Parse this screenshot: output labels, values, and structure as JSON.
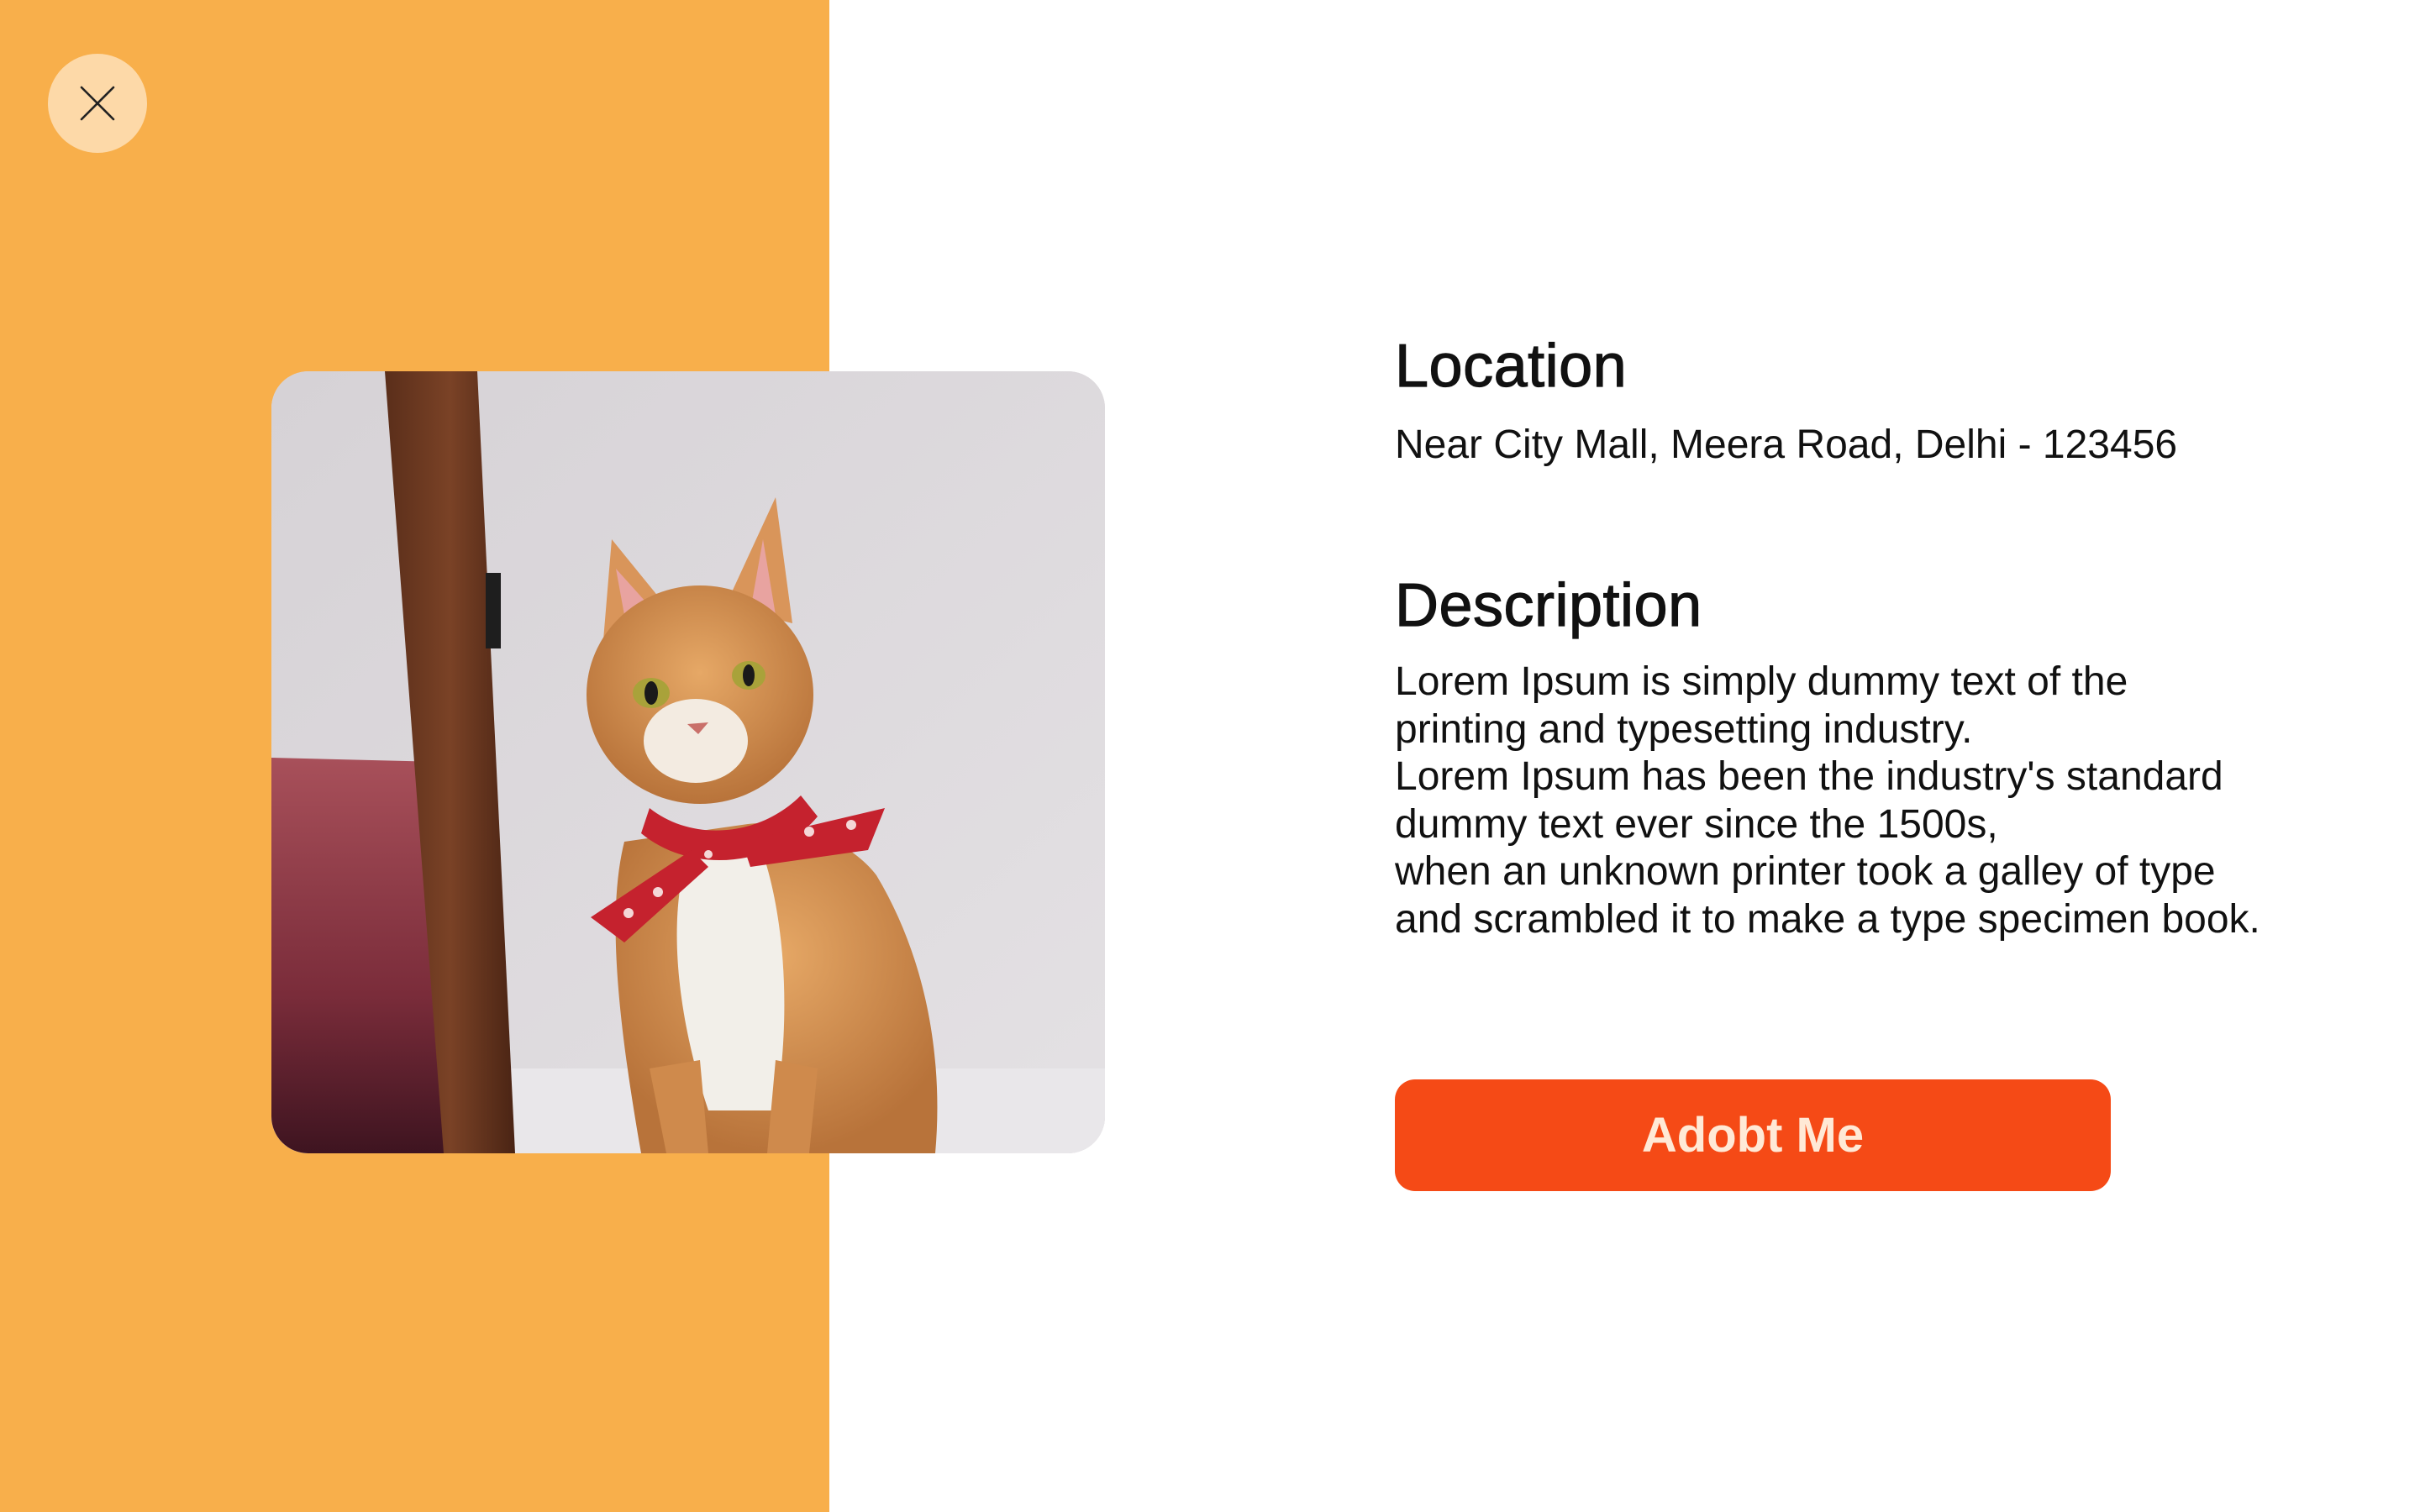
{
  "close": {
    "icon": "close-icon"
  },
  "photo": {
    "subject": "cat-photo"
  },
  "location": {
    "title": "Location",
    "address": "Near City Mall, Meera Road, Delhi - 123456"
  },
  "description": {
    "title": "Description",
    "lines": [
      "Lorem Ipsum is simply dummy text of the",
      "printing and typesetting industry.",
      "Lorem Ipsum has been the industry's standard",
      "dummy text ever since the 1500s,",
      "when an unknown printer took a galley of type",
      "and scrambled it to make a type specimen book."
    ]
  },
  "actions": {
    "adopt_label": "Adobt Me"
  },
  "colors": {
    "panel": "#F8AF4B",
    "close_bg": "#FDD9A8",
    "button": "#F54A16",
    "button_text": "#FFE9D6"
  }
}
